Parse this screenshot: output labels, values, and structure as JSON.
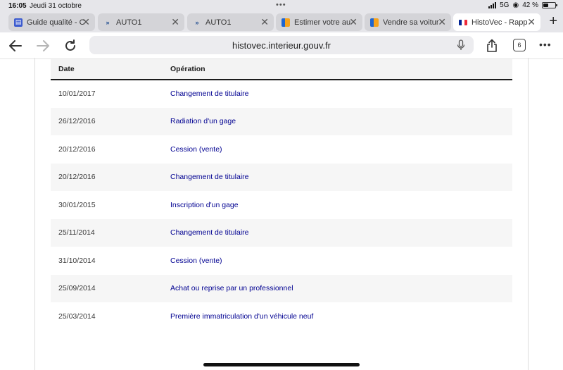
{
  "status_bar": {
    "time": "16:05",
    "date": "Jeudi 31 octobre",
    "network": "5G",
    "battery": "42 %"
  },
  "tabs": [
    {
      "label": "Guide qualité - C",
      "icon": "guide-icon"
    },
    {
      "label": "AUTO1",
      "icon": "auto1-icon"
    },
    {
      "label": "AUTO1",
      "icon": "auto1-icon"
    },
    {
      "label": "Estimer votre au",
      "icon": "flag-icon"
    },
    {
      "label": "Vendre sa voitur",
      "icon": "flag-icon"
    },
    {
      "label": "HistoVec - Rapp",
      "icon": "french-flag-icon",
      "active": true
    }
  ],
  "toolbar": {
    "url": "histovec.interieur.gouv.fr",
    "tab_count": "6"
  },
  "table": {
    "headers": {
      "date": "Date",
      "operation": "Opération"
    },
    "rows": [
      {
        "date": "10/01/2017",
        "operation": "Changement de titulaire"
      },
      {
        "date": "26/12/2016",
        "operation": "Radiation d'un gage"
      },
      {
        "date": "20/12/2016",
        "operation": "Cession (vente)"
      },
      {
        "date": "20/12/2016",
        "operation": "Changement de titulaire"
      },
      {
        "date": "30/01/2015",
        "operation": "Inscription d'un gage"
      },
      {
        "date": "25/11/2014",
        "operation": "Changement de titulaire"
      },
      {
        "date": "31/10/2014",
        "operation": "Cession (vente)"
      },
      {
        "date": "25/09/2014",
        "operation": "Achat ou reprise par un professionnel"
      },
      {
        "date": "25/03/2014",
        "operation": "Première immatriculation d'un véhicule neuf"
      }
    ]
  },
  "colors": {
    "link": "#000091",
    "row_alt": "#f6f6f6"
  }
}
